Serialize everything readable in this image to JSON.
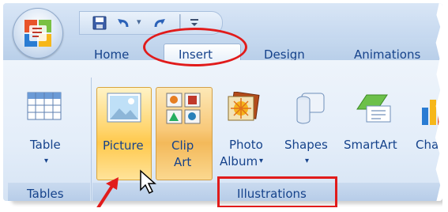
{
  "tabs": {
    "home": "Home",
    "insert": "Insert",
    "design": "Design",
    "animations": "Animations"
  },
  "quick_access_toolbar": {
    "items": [
      "save-icon",
      "undo-icon",
      "dropdown-arrow-icon",
      "redo-icon",
      "customize-icon"
    ],
    "separator": "│"
  },
  "groups": {
    "tables": {
      "label": "Tables",
      "table_button": {
        "label": "Table",
        "dropdown": "▾"
      }
    },
    "illustrations": {
      "label": "Illustrations",
      "picture_button": {
        "label": "Picture"
      },
      "clip_art_button": {
        "label_line1": "Clip",
        "label_line2": "Art"
      },
      "photo_album_button": {
        "label_line1": "Photo",
        "label_line2": "Album",
        "dropdown": "▾"
      },
      "shapes_button": {
        "label": "Shapes",
        "dropdown": "▾"
      },
      "smartart_button": {
        "label": "SmartArt"
      },
      "chart_button": {
        "label": "Cha"
      }
    }
  },
  "annotations": {
    "highlight_color": "#e11b1b",
    "circled_tab": "insert",
    "boxed_group": "illustrations",
    "arrow_target": "picture_button"
  },
  "colors": {
    "ribbon_text": "#15428b",
    "hover_highlight": "#ffd56e"
  }
}
